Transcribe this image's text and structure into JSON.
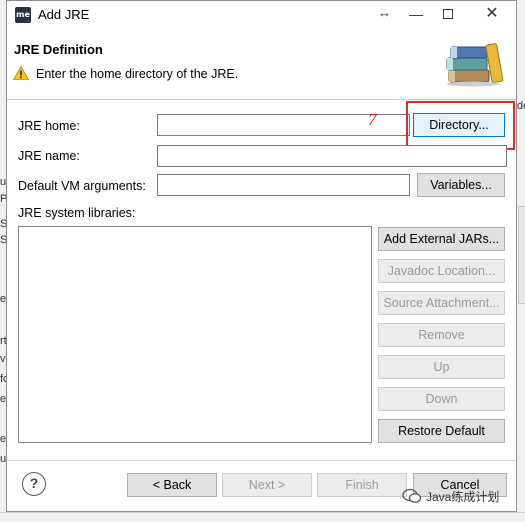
{
  "window": {
    "title": "Add JRE",
    "app_icon_text": "me",
    "minimize_glyph": "—",
    "close_glyph": "✕",
    "resize_glyph": "↔"
  },
  "header": {
    "title": "JRE Definition",
    "message": "Enter the home directory of the JRE."
  },
  "form": {
    "jre_home_label": "JRE home:",
    "jre_home_value": "",
    "directory_button": "Directory...",
    "jre_name_label": "JRE name:",
    "jre_name_value": "",
    "vm_args_label": "Default VM arguments:",
    "vm_args_value": "",
    "variables_button": "Variables...",
    "libraries_label": "JRE system libraries:"
  },
  "library_buttons": {
    "add_external": "Add External JARs...",
    "javadoc": "Javadoc Location...",
    "source": "Source Attachment...",
    "remove": "Remove",
    "up": "Up",
    "down": "Down",
    "restore": "Restore Default"
  },
  "footer": {
    "help": "?",
    "back": "< Back",
    "next": "Next >",
    "finish": "Finish",
    "cancel": "Cancel"
  },
  "annotation": {
    "marker": "7"
  },
  "watermark": {
    "text": "Java练成计划"
  },
  "background": {
    "left_fragments": [
      "ur",
      "Pa",
      "Sl",
      "Sl",
      "ed",
      "rt",
      "vi",
      "fo",
      "e",
      "ev",
      "ug"
    ],
    "right_fragment": "de"
  },
  "colors": {
    "highlight": "#e02a2a",
    "accent": "#0078d7"
  }
}
